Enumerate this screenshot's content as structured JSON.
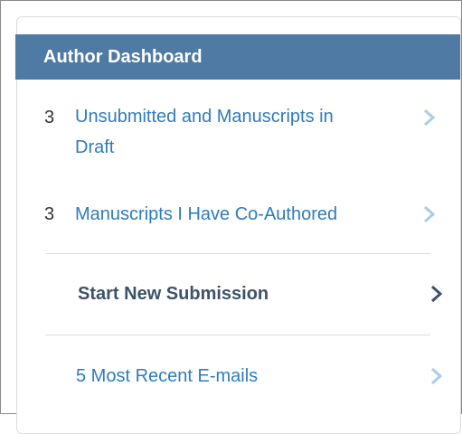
{
  "dashboard": {
    "title": "Author Dashboard",
    "items": [
      {
        "count": "3",
        "label_line1": "Unsubmitted and Manuscripts in",
        "label_line2": "Draft",
        "chevron": "chevron-right-icon"
      },
      {
        "count": "3",
        "label": "Manuscripts I Have Co-Authored",
        "chevron": "chevron-right-icon"
      }
    ],
    "start_new_label": "Start New Submission",
    "recent_emails_label": "5 Most Recent E-mails"
  },
  "colors": {
    "header_bg": "#4f7aa3",
    "link": "#2f7bbf",
    "bold_link": "#3d5269",
    "chevron_light": "#a9cce8",
    "chevron_dark": "#3d5269"
  }
}
